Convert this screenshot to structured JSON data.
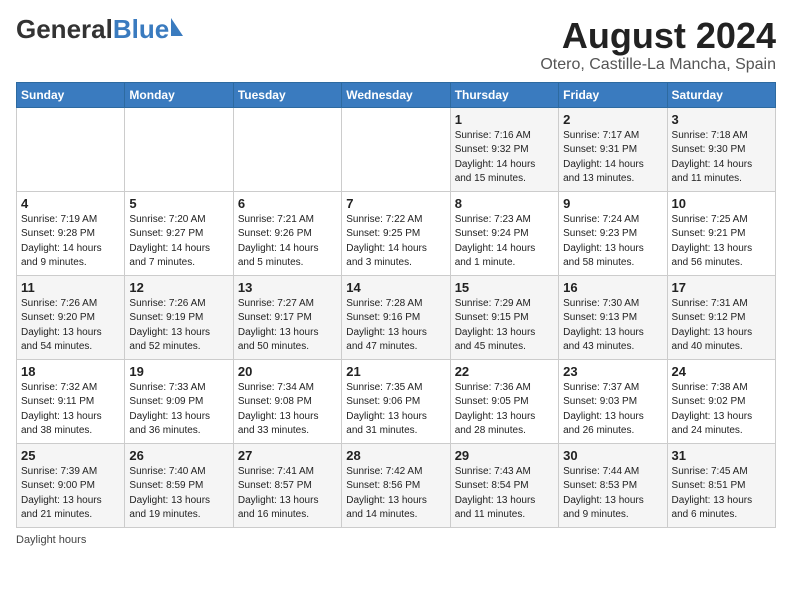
{
  "header": {
    "logo_general": "General",
    "logo_blue": "Blue",
    "month_year": "August 2024",
    "location": "Otero, Castille-La Mancha, Spain"
  },
  "days_of_week": [
    "Sunday",
    "Monday",
    "Tuesday",
    "Wednesday",
    "Thursday",
    "Friday",
    "Saturday"
  ],
  "weeks": [
    [
      {
        "day": "",
        "info": ""
      },
      {
        "day": "",
        "info": ""
      },
      {
        "day": "",
        "info": ""
      },
      {
        "day": "",
        "info": ""
      },
      {
        "day": "1",
        "info": "Sunrise: 7:16 AM\nSunset: 9:32 PM\nDaylight: 14 hours\nand 15 minutes."
      },
      {
        "day": "2",
        "info": "Sunrise: 7:17 AM\nSunset: 9:31 PM\nDaylight: 14 hours\nand 13 minutes."
      },
      {
        "day": "3",
        "info": "Sunrise: 7:18 AM\nSunset: 9:30 PM\nDaylight: 14 hours\nand 11 minutes."
      }
    ],
    [
      {
        "day": "4",
        "info": "Sunrise: 7:19 AM\nSunset: 9:28 PM\nDaylight: 14 hours\nand 9 minutes."
      },
      {
        "day": "5",
        "info": "Sunrise: 7:20 AM\nSunset: 9:27 PM\nDaylight: 14 hours\nand 7 minutes."
      },
      {
        "day": "6",
        "info": "Sunrise: 7:21 AM\nSunset: 9:26 PM\nDaylight: 14 hours\nand 5 minutes."
      },
      {
        "day": "7",
        "info": "Sunrise: 7:22 AM\nSunset: 9:25 PM\nDaylight: 14 hours\nand 3 minutes."
      },
      {
        "day": "8",
        "info": "Sunrise: 7:23 AM\nSunset: 9:24 PM\nDaylight: 14 hours\nand 1 minute."
      },
      {
        "day": "9",
        "info": "Sunrise: 7:24 AM\nSunset: 9:23 PM\nDaylight: 13 hours\nand 58 minutes."
      },
      {
        "day": "10",
        "info": "Sunrise: 7:25 AM\nSunset: 9:21 PM\nDaylight: 13 hours\nand 56 minutes."
      }
    ],
    [
      {
        "day": "11",
        "info": "Sunrise: 7:26 AM\nSunset: 9:20 PM\nDaylight: 13 hours\nand 54 minutes."
      },
      {
        "day": "12",
        "info": "Sunrise: 7:26 AM\nSunset: 9:19 PM\nDaylight: 13 hours\nand 52 minutes."
      },
      {
        "day": "13",
        "info": "Sunrise: 7:27 AM\nSunset: 9:17 PM\nDaylight: 13 hours\nand 50 minutes."
      },
      {
        "day": "14",
        "info": "Sunrise: 7:28 AM\nSunset: 9:16 PM\nDaylight: 13 hours\nand 47 minutes."
      },
      {
        "day": "15",
        "info": "Sunrise: 7:29 AM\nSunset: 9:15 PM\nDaylight: 13 hours\nand 45 minutes."
      },
      {
        "day": "16",
        "info": "Sunrise: 7:30 AM\nSunset: 9:13 PM\nDaylight: 13 hours\nand 43 minutes."
      },
      {
        "day": "17",
        "info": "Sunrise: 7:31 AM\nSunset: 9:12 PM\nDaylight: 13 hours\nand 40 minutes."
      }
    ],
    [
      {
        "day": "18",
        "info": "Sunrise: 7:32 AM\nSunset: 9:11 PM\nDaylight: 13 hours\nand 38 minutes."
      },
      {
        "day": "19",
        "info": "Sunrise: 7:33 AM\nSunset: 9:09 PM\nDaylight: 13 hours\nand 36 minutes."
      },
      {
        "day": "20",
        "info": "Sunrise: 7:34 AM\nSunset: 9:08 PM\nDaylight: 13 hours\nand 33 minutes."
      },
      {
        "day": "21",
        "info": "Sunrise: 7:35 AM\nSunset: 9:06 PM\nDaylight: 13 hours\nand 31 minutes."
      },
      {
        "day": "22",
        "info": "Sunrise: 7:36 AM\nSunset: 9:05 PM\nDaylight: 13 hours\nand 28 minutes."
      },
      {
        "day": "23",
        "info": "Sunrise: 7:37 AM\nSunset: 9:03 PM\nDaylight: 13 hours\nand 26 minutes."
      },
      {
        "day": "24",
        "info": "Sunrise: 7:38 AM\nSunset: 9:02 PM\nDaylight: 13 hours\nand 24 minutes."
      }
    ],
    [
      {
        "day": "25",
        "info": "Sunrise: 7:39 AM\nSunset: 9:00 PM\nDaylight: 13 hours\nand 21 minutes."
      },
      {
        "day": "26",
        "info": "Sunrise: 7:40 AM\nSunset: 8:59 PM\nDaylight: 13 hours\nand 19 minutes."
      },
      {
        "day": "27",
        "info": "Sunrise: 7:41 AM\nSunset: 8:57 PM\nDaylight: 13 hours\nand 16 minutes."
      },
      {
        "day": "28",
        "info": "Sunrise: 7:42 AM\nSunset: 8:56 PM\nDaylight: 13 hours\nand 14 minutes."
      },
      {
        "day": "29",
        "info": "Sunrise: 7:43 AM\nSunset: 8:54 PM\nDaylight: 13 hours\nand 11 minutes."
      },
      {
        "day": "30",
        "info": "Sunrise: 7:44 AM\nSunset: 8:53 PM\nDaylight: 13 hours\nand 9 minutes."
      },
      {
        "day": "31",
        "info": "Sunrise: 7:45 AM\nSunset: 8:51 PM\nDaylight: 13 hours\nand 6 minutes."
      }
    ]
  ],
  "footer": {
    "daylight_hours_label": "Daylight hours"
  }
}
